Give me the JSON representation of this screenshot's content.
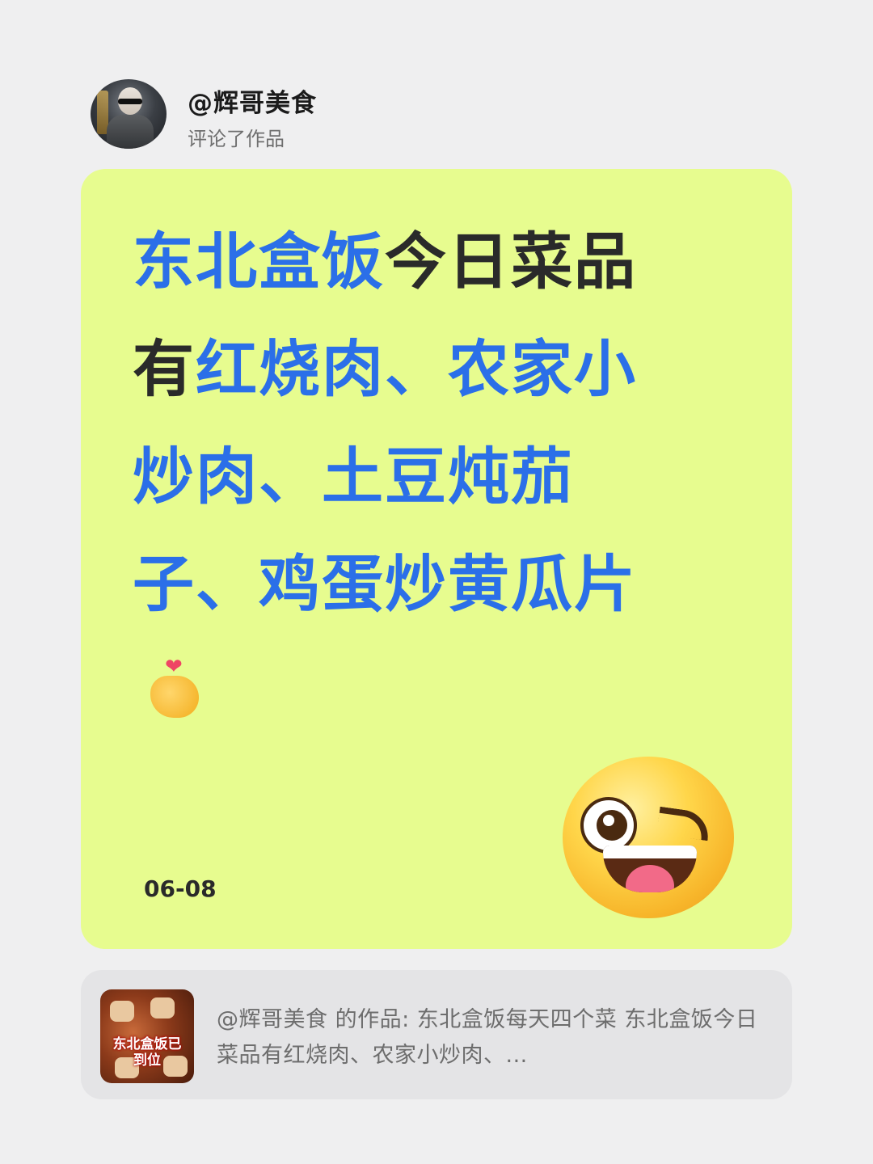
{
  "header": {
    "username": "@辉哥美食",
    "action": "评论了作品"
  },
  "comment": {
    "segments": [
      {
        "text": "东北盒饭",
        "color": "blue"
      },
      {
        "text": "今日菜品有",
        "color": "dark"
      },
      {
        "text": "红烧肉、农家小炒肉、土豆炖茄子、鸡蛋炒黄瓜片",
        "color": "blue"
      }
    ],
    "inline_emoji": "finger-heart-icon",
    "date": "06-08",
    "sticker": "winking-tongue-emoji"
  },
  "reference": {
    "thumbnail_text": "东北盒饭已到位",
    "text": "@辉哥美食 的作品: 东北盒饭每天四个菜 东北盒饭今日菜品有红烧肉、农家小炒肉、..."
  },
  "colors": {
    "background": "#efeff0",
    "card": "#e7fc8f",
    "accent_blue": "#2b6fe8",
    "text_dark": "#2a2a2a"
  }
}
